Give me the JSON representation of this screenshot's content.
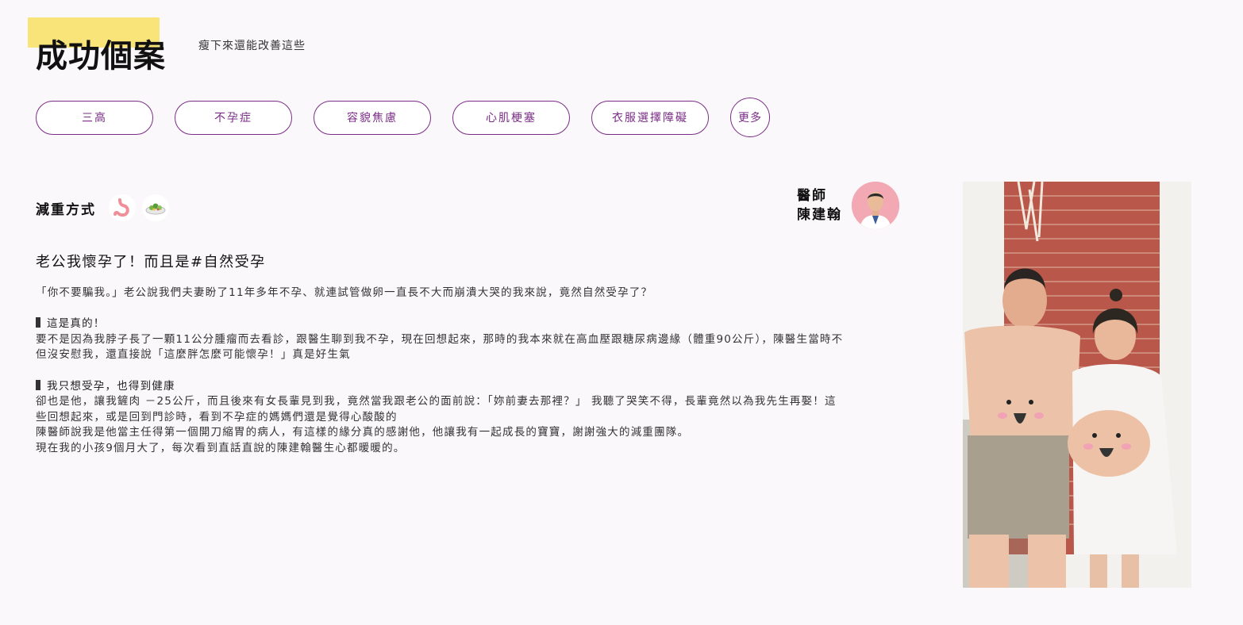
{
  "header": {
    "title": "成功個案",
    "subtitle": "瘦下來還能改善這些"
  },
  "tags": [
    "三高",
    "不孕症",
    "容貌焦慮",
    "心肌梗塞",
    "衣服選擇障礙"
  ],
  "more_label": "更多",
  "method": {
    "label": "減重方式",
    "icons": [
      "stomach-icon",
      "salad-icon"
    ]
  },
  "doctor": {
    "line1": "醫師",
    "line2": "陳建翰"
  },
  "case": {
    "title": "老公我懷孕了！而且是#自然受孕",
    "intro": "「你不要騙我。」老公說我們夫妻盼了11年多年不孕、就連試管做卵一直長不大而崩潰大哭的我來說，竟然自然受孕了？",
    "section1_heading": "這是真的！",
    "section1_lines": [
      "要不是因為我脖子長了一顆11公分腫瘤而去看診，跟醫生聊到我不孕，現在回想起來，那時的我本來就在高血壓跟糖尿病邊緣（體重90公斤），陳醫生當時不",
      "但沒安慰我，還直接說「這麼胖怎麼可能懷孕！」真是好生氣"
    ],
    "section2_heading": "我只想受孕，也得到健康",
    "section2_lines": [
      "卻也是他，讓我鏟肉 －25公斤，而且後來有女長輩見到我，竟然當我跟老公的面前說：「妳前妻去那裡？」 我聽了哭笑不得，長輩竟然以為我先生再娶！這",
      "些回想起來，或是回到門診時，看到不孕症的媽媽們還是覺得心酸酸的",
      "陳醫師說我是他當主任得第一個開刀縮胃的病人，有這樣的緣分真的感謝他，他讓我有一起成長的寶寶，謝謝強大的減重團隊。",
      "現在我的小孩9個月大了，每次看到直話直說的陳建翰醫生心都暖暖的。"
    ]
  },
  "colors": {
    "accent": "#7a2c86",
    "highlight": "#f8e479",
    "background": "#fbf8fb",
    "avatar_bg": "#f2a9b4"
  }
}
